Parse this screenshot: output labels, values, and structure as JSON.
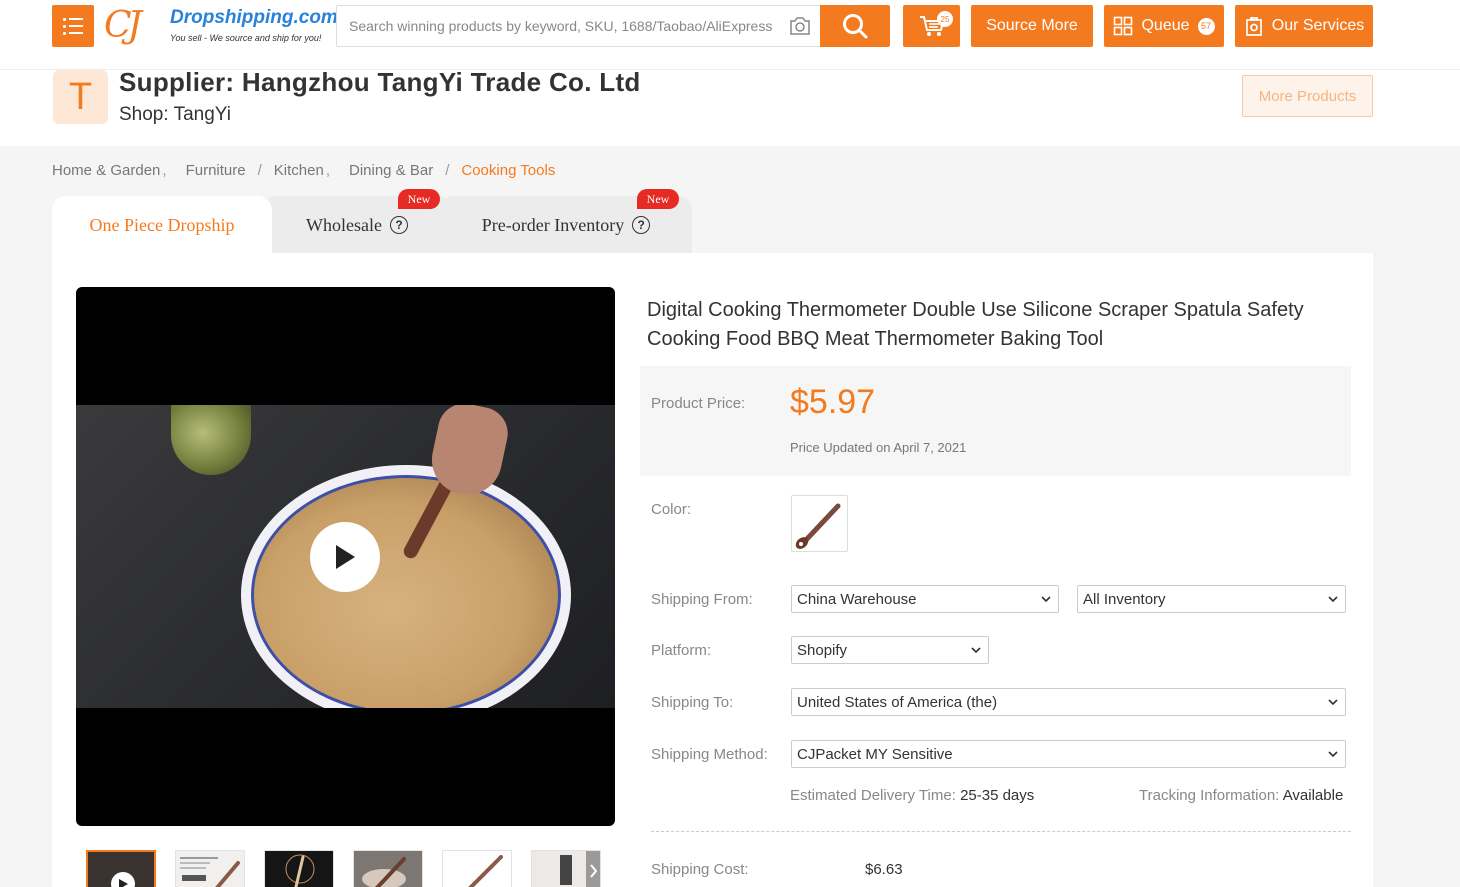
{
  "header": {
    "brand": "Dropshipping.com",
    "tagline": "You sell - We source and ship for you!",
    "search_placeholder": "Search winning products by keyword, SKU, 1688/Taobao/AliExpress URL",
    "cart_count": "25",
    "source_more_label": "Source More",
    "queue_label": "Queue",
    "queue_count": "57",
    "our_services_label": "Our Services",
    "accent_color": "#f47a20"
  },
  "supplier": {
    "avatar_letter": "T",
    "name": "Supplier: Hangzhou TangYi Trade Co. Ltd",
    "shop": "Shop: TangYi",
    "more_products_label": "More Products"
  },
  "breadcrumb": {
    "items": [
      "Home & Garden",
      "Furniture",
      "Kitchen",
      "Dining & Bar",
      "Cooking Tools"
    ]
  },
  "tabs": {
    "one_piece": "One Piece Dropship",
    "wholesale": "Wholesale",
    "preorder": "Pre-order Inventory",
    "new_badge": "New"
  },
  "product": {
    "title": "Digital Cooking Thermometer Double Use Silicone Scraper Spatula Safety Cooking Food BBQ Meat Thermometer Baking Tool",
    "price_label": "Product Price:",
    "price": "$5.97",
    "price_updated": "Price Updated on April 7, 2021",
    "color_label": "Color:",
    "shipping_from_label": "Shipping From:",
    "shipping_from_value": "China Warehouse",
    "inventory_value": "All Inventory",
    "platform_label": "Platform:",
    "platform_value": "Shopify",
    "shipping_to_label": "Shipping To:",
    "shipping_to_value": "United States of America (the)",
    "shipping_method_label": "Shipping Method:",
    "shipping_method_value": "CJPacket MY Sensitive",
    "delivery_label": "Estimated Delivery Time:",
    "delivery_value": "25-35 days",
    "tracking_label": "Tracking Information:",
    "tracking_value": "Available",
    "shipping_cost_label": "Shipping Cost:",
    "shipping_cost_value": "$6.63"
  },
  "media": {
    "play_icon": "play-icon",
    "thumbnail_count": 6
  }
}
